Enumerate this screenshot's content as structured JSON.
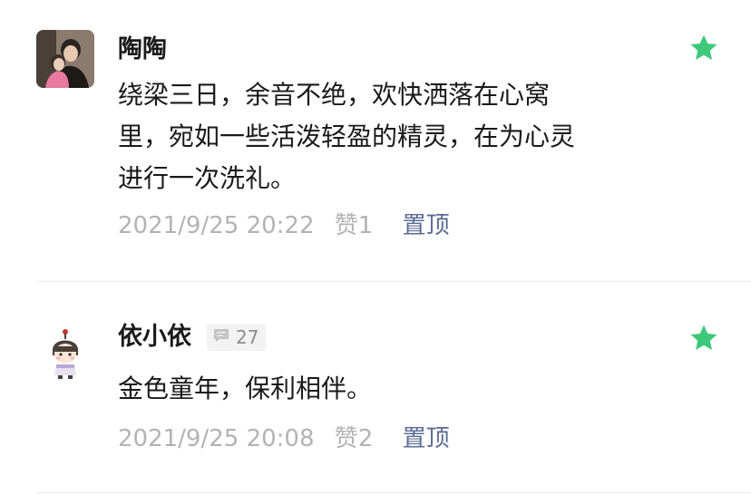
{
  "comments": [
    {
      "username": "陶陶",
      "content_lines": [
        "绕梁三日，余音不绝，欢快洒落在心窝",
        "里，宛如一些活泼轻盈的精灵，在为心灵",
        "进行一次洗礼。"
      ],
      "timestamp": "2021/9/25 20:22",
      "likes": "赞1",
      "pin_label": "置顶",
      "starred": true
    },
    {
      "username": "依小依",
      "badge_count": "27",
      "content_lines": [
        "金色童年，保利相伴。"
      ],
      "timestamp": "2021/9/25 20:08",
      "likes": "赞2",
      "pin_label": "置顶",
      "starred": true
    }
  ],
  "colors": {
    "star": "#3ec97a",
    "pin_link": "#5b6b93",
    "meta_text": "#b3b3b3"
  },
  "icons": {
    "star": "star-icon",
    "comment_bubble": "comment-bubble-icon"
  }
}
